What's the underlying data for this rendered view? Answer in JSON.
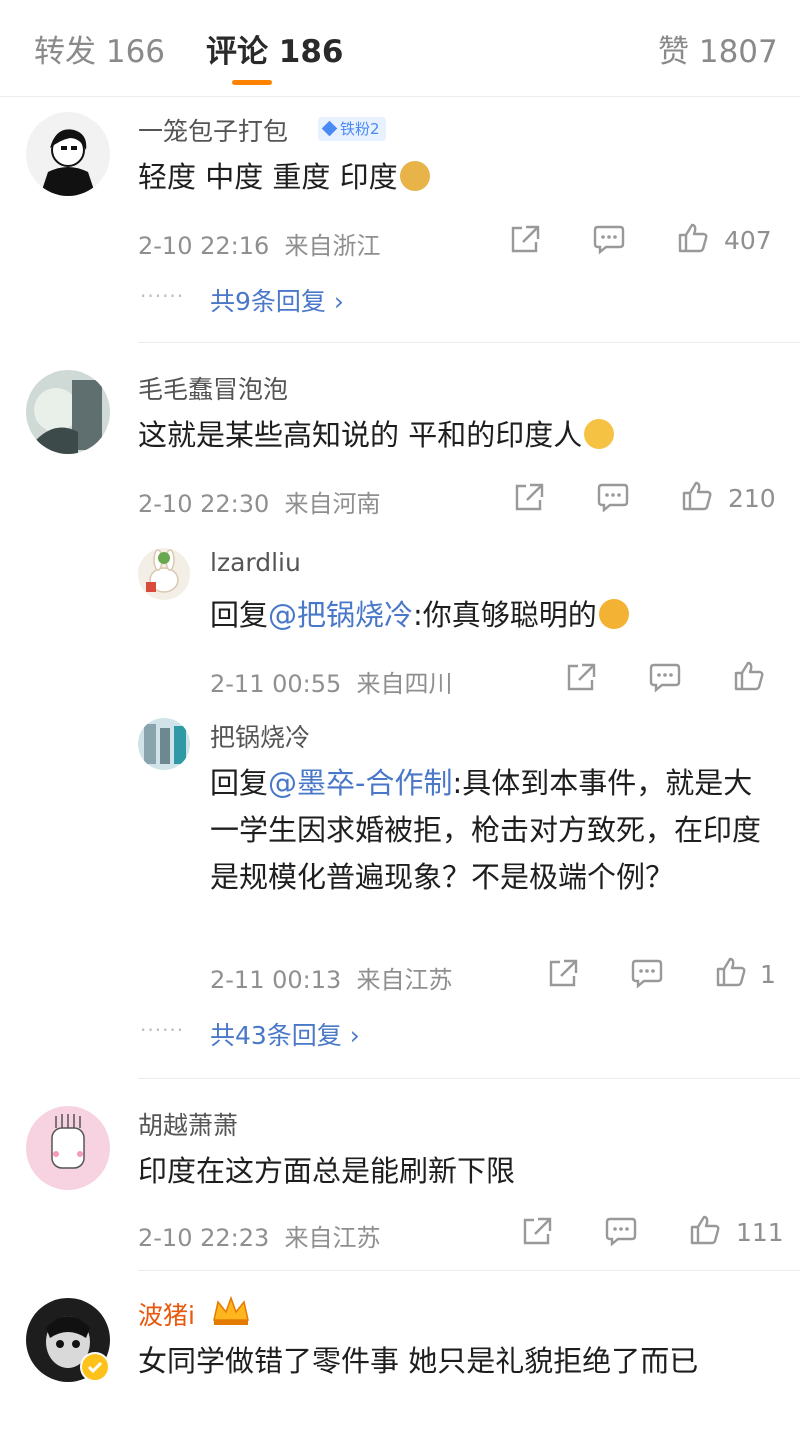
{
  "tabs": {
    "repost": "转发 166",
    "comment": "评论 186",
    "like": "赞 1807"
  },
  "comments": [
    {
      "username": "一笼包子打包",
      "badge": "铁粉2",
      "text": "轻度 中度 重度 印度",
      "emoji": "doge",
      "time": "2-10 22:16",
      "location": "来自浙江",
      "likes": "407",
      "replies_link": "共9条回复 ›"
    },
    {
      "username": "毛毛蠢冒泡泡",
      "text": "这就是某些高知说的 平和的印度人",
      "emoji": "smirk",
      "time": "2-10 22:30",
      "location": "来自河南",
      "likes": "210",
      "replies_link": "共43条回复 ›",
      "sub_replies": [
        {
          "username": "lzardliu",
          "prefix": "回复",
          "mention": "@把锅烧冷",
          "text": ":你真够聪明的",
          "emoji": "hug",
          "time": "2-11 00:55",
          "location": "来自四川",
          "likes": ""
        },
        {
          "username": "把锅烧冷",
          "prefix": "回复",
          "mention": "@墨卒-合作制",
          "text_line1": ":具体到本事件，就",
          "text_rest": "是大一学生因求婚被拒，枪击对方致死，在印度是规模化普遍现象？不是极端个例？",
          "time": "2-11 00:13",
          "location": "来自江苏",
          "likes": "1"
        }
      ]
    },
    {
      "username": "胡越萧萧",
      "text": "印度在这方面总是能刷新下限",
      "time": "2-10 22:23",
      "location": "来自江苏",
      "likes": "111"
    },
    {
      "username": "波猪i",
      "text": "女同学做错了零件事 她只是礼貌拒绝了而已"
    }
  ],
  "colors": {
    "accent": "#ff8200",
    "link": "#4a78c8",
    "meta": "#8f8f8f"
  }
}
